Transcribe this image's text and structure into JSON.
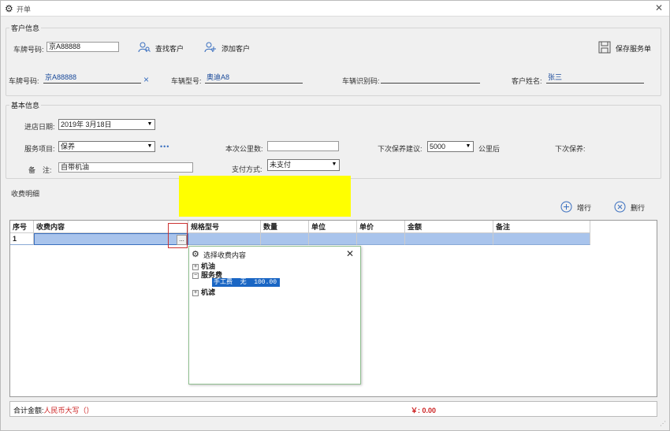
{
  "window": {
    "title": "开单",
    "close": "✕"
  },
  "customer_info": {
    "legend": "客户信息",
    "plate_label": "车牌号码:",
    "plate_value": "京A88888",
    "find_customer": "查找客户",
    "add_customer": "添加客户",
    "save_order": "保存服务单",
    "plate2_label": "车牌号码:",
    "plate2_value": "京A88888",
    "plate2_clear": "×",
    "model_label": "车辆型号:",
    "model_value": "奥迪A8",
    "vin_label": "车辆识别码:",
    "vin_value": "",
    "name_label": "客户姓名:",
    "name_value": "张三"
  },
  "basic_info": {
    "legend": "基本信息",
    "date_label": "进店日期:",
    "date_value": "2019年 3月18日",
    "service_label": "服务项目:",
    "service_value": "保养",
    "service_more": "•••",
    "mileage_label": "本次公里数:",
    "mileage_value": "",
    "next_suggest_label": "下次保养建议:",
    "next_suggest_value": "5000",
    "next_suggest_unit": "公里后",
    "next_label": "下次保养:",
    "remark_label": "备　注:",
    "remark_value": "自带机油",
    "pay_label": "支付方式:",
    "pay_value": "未支付"
  },
  "fee_detail": {
    "legend": "收费明细",
    "add_row": "增行",
    "del_row": "删行",
    "columns": [
      "序号",
      "收费内容",
      "规格型号",
      "数量",
      "单位",
      "单价",
      "金额",
      "备注"
    ],
    "rows": [
      {
        "idx": "1",
        "content": "",
        "spec": "",
        "qty": "",
        "unit": "",
        "price": "",
        "amount": "",
        "remark": ""
      }
    ],
    "ellipsis": "..."
  },
  "popup": {
    "title": "选择收费内容",
    "close": "✕",
    "tree": [
      {
        "toggle": "+",
        "label": "机油"
      },
      {
        "toggle": "−",
        "label": "服务费"
      },
      {
        "toggle": "+",
        "label": "机滤"
      }
    ],
    "selected_child": "手工费  无  100.00"
  },
  "footer": {
    "total_label": "合计金额:",
    "caps_label": "人民币大写（）",
    "amount": "￥: 0.00"
  },
  "colors": {
    "accent": "#3a6fbf",
    "row_selected": "#a9c4ec",
    "highlight": "#ffff00",
    "tree_selected": "#1a66c4",
    "amount": "#cc2222"
  }
}
